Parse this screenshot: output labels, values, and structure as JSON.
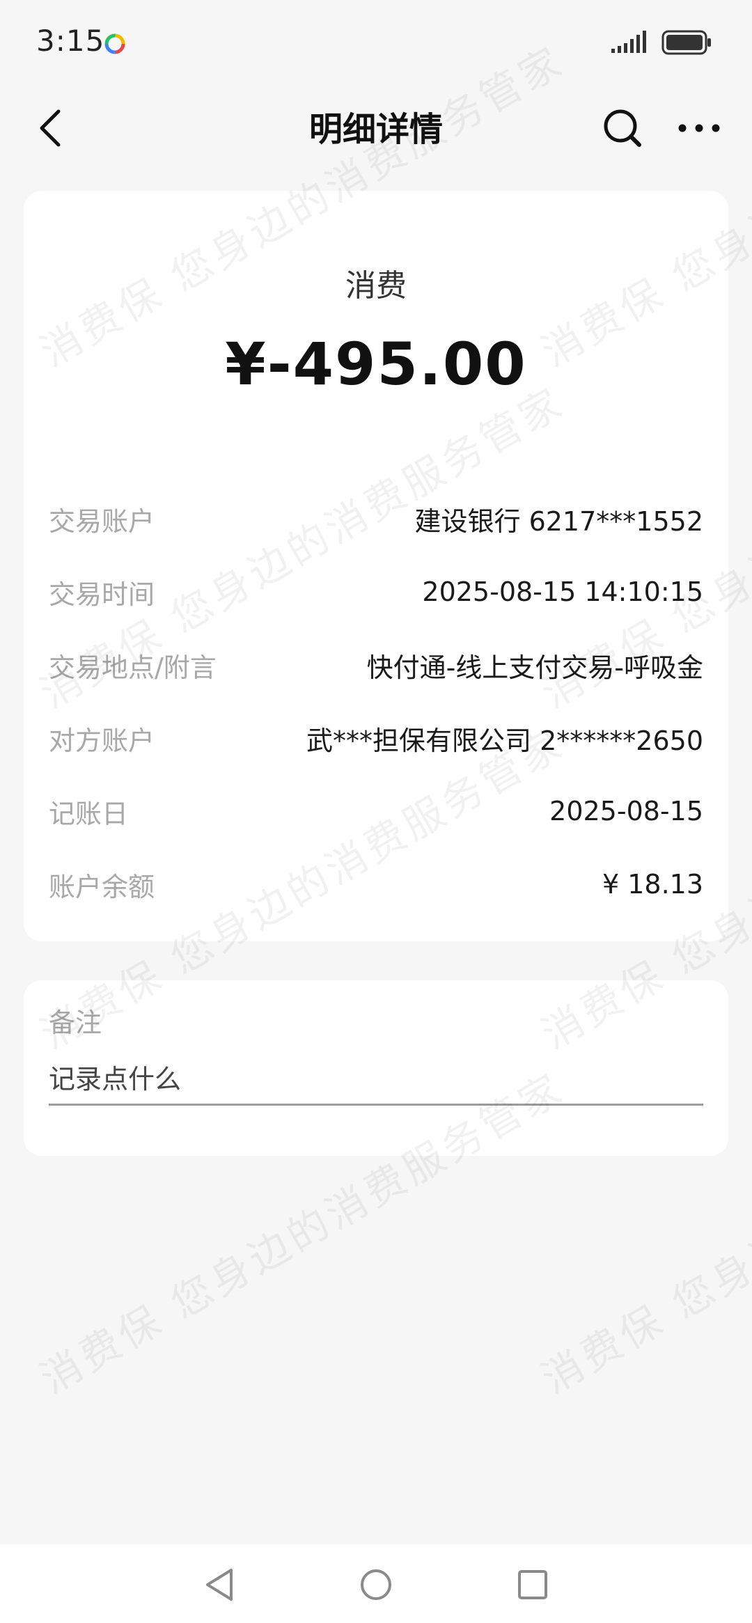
{
  "status_bar": {
    "time": "3:15",
    "icons": [
      "app-notification-icon",
      "signal-icon",
      "battery-icon"
    ]
  },
  "header": {
    "title": "明细详情",
    "icons": [
      "back-arrow-icon",
      "search-icon",
      "more-icon"
    ]
  },
  "transaction": {
    "type": "消费",
    "amount": "¥-495.00",
    "rows": [
      {
        "label": "交易账户",
        "value": "建设银行 6217***1552"
      },
      {
        "label": "交易时间",
        "value": "2025-08-15 14:10:15"
      },
      {
        "label": "交易地点/附言",
        "value": "快付通-线上支付交易-呼吸金"
      },
      {
        "label": "对方账户",
        "value": "武***担保有限公司 2******2650"
      },
      {
        "label": "记账日",
        "value": "2025-08-15"
      },
      {
        "label": "账户余额",
        "value": "¥ 18.13"
      }
    ]
  },
  "note": {
    "title": "备注",
    "placeholder": "记录点什么"
  },
  "watermark": {
    "line_a": "消费保 您身边的消费服务管家"
  },
  "nav": {
    "icons": [
      "nav-back-icon",
      "nav-home-icon",
      "nav-recents-icon"
    ]
  },
  "colors": {
    "background": "#f6f6f6",
    "card": "#ffffff",
    "label": "#a8a8a8",
    "text": "#1a1a1a"
  }
}
